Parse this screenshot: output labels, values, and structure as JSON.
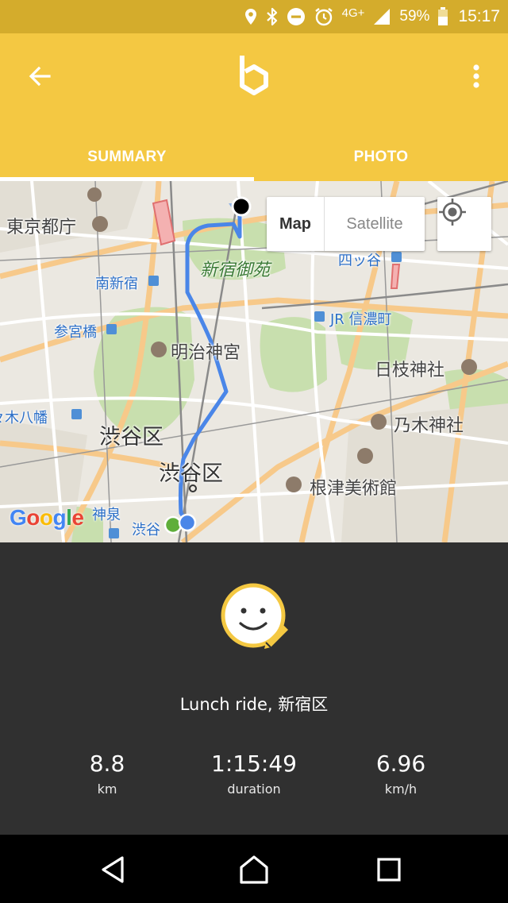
{
  "status_bar": {
    "network": "4G+",
    "battery": "59%",
    "time": "15:17",
    "icons": [
      "location-icon",
      "bluetooth-icon",
      "do-not-disturb-icon",
      "alarm-icon",
      "signal-icon",
      "battery-icon"
    ]
  },
  "app_bar": {
    "back_icon": "arrow-back-icon",
    "logo": "app-logo",
    "menu_icon": "more-vert-icon",
    "background": "#f4c842",
    "status_bar_background": "#d4ac2c"
  },
  "tabs": [
    {
      "label": "SUMMARY",
      "active": true
    },
    {
      "label": "PHOTO",
      "active": false
    }
  ],
  "map": {
    "map_type": {
      "map": "Map",
      "satellite": "Satellite",
      "selected": "Map"
    },
    "provider": "Google",
    "route_color": "#4a86e8",
    "labels": {
      "tokyo_metro_govt": "東京都庁",
      "minami_shinjuku": "南新宿",
      "sangubashi": "参宮橋",
      "meiji_jingu": "明治神宮",
      "shinjuku_gyoen": "新宿御苑",
      "yotsuya": "四ッ谷",
      "shinanomachi": "JR 信濃町",
      "hie_jinja": "日枝神社",
      "yoyogi_hachiman": "代々木八幡",
      "shibuya_ku_district": "渋谷区",
      "nogi_jinja": "乃木神社",
      "shibuya_ku_office": "渋谷区",
      "nezu_museum": "根津美術館",
      "shinsen": "神泉",
      "shibuya": "渋谷"
    }
  },
  "ride": {
    "mood_icon": "smiley-edit-icon",
    "title": "Lunch ride, 新宿区",
    "stats": [
      {
        "value": "8.8",
        "unit": "km"
      },
      {
        "value": "1:15:49",
        "unit": "duration"
      },
      {
        "value": "6.96",
        "unit": "km/h"
      }
    ]
  },
  "nav_bar": {
    "icons": [
      "back-triangle-icon",
      "home-circle-icon",
      "recents-square-icon"
    ]
  }
}
